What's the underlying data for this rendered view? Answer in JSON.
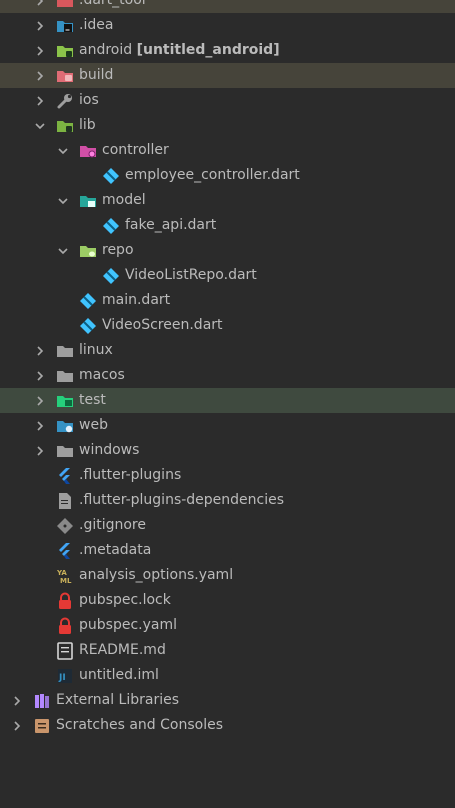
{
  "tree": [
    {
      "label": ".dart_tool",
      "depth": 1,
      "chev": "right",
      "icon": "folder-excluded-icon",
      "color": "#d9585d",
      "hl": "olive"
    },
    {
      "label": ".idea",
      "depth": 1,
      "chev": "right",
      "icon": "idea-folder-icon",
      "color": "#3592c4"
    },
    {
      "label": "android",
      "suffix": "[untitled_android]",
      "depth": 1,
      "chev": "right",
      "icon": "android-module-folder-icon",
      "color": "#8bc34a"
    },
    {
      "label": "build",
      "depth": 1,
      "chev": "right",
      "icon": "build-folder-icon",
      "color": "#e06c75",
      "hl": "olive"
    },
    {
      "label": "ios",
      "depth": 1,
      "chev": "right",
      "icon": "wrench-icon",
      "color": "#9e9e9e"
    },
    {
      "label": "lib",
      "depth": 1,
      "chev": "down",
      "icon": "source-folder-icon",
      "color": "#7cb342"
    },
    {
      "label": "controller",
      "depth": 2,
      "chev": "down",
      "icon": "controller-folder-icon",
      "color": "#e040fb"
    },
    {
      "label": "employee_controller.dart",
      "depth": 3,
      "icon": "dart-file-icon",
      "color": "#40c4ff"
    },
    {
      "label": "model",
      "depth": 2,
      "chev": "down",
      "icon": "model-folder-icon",
      "color": "#26a69a"
    },
    {
      "label": "fake_api.dart",
      "depth": 3,
      "icon": "dart-file-icon",
      "color": "#40c4ff"
    },
    {
      "label": "repo",
      "depth": 2,
      "chev": "down",
      "icon": "repo-folder-icon",
      "color": "#9ccc65"
    },
    {
      "label": "VideoListRepo.dart",
      "depth": 3,
      "icon": "dart-file-icon",
      "color": "#40c4ff"
    },
    {
      "label": "main.dart",
      "depth": 2,
      "icon": "dart-file-icon",
      "color": "#40c4ff"
    },
    {
      "label": "VideoScreen.dart",
      "depth": 2,
      "icon": "dart-file-icon",
      "color": "#40c4ff"
    },
    {
      "label": "linux",
      "depth": 1,
      "chev": "right",
      "icon": "folder-icon",
      "color": "#9e9e9e"
    },
    {
      "label": "macos",
      "depth": 1,
      "chev": "right",
      "icon": "folder-icon",
      "color": "#9e9e9e"
    },
    {
      "label": "test",
      "depth": 1,
      "chev": "right",
      "icon": "test-folder-icon",
      "color": "#26d07c",
      "hl": "green"
    },
    {
      "label": "web",
      "depth": 1,
      "chev": "right",
      "icon": "web-folder-icon",
      "color": "#3592c4"
    },
    {
      "label": "windows",
      "depth": 1,
      "chev": "right",
      "icon": "folder-icon",
      "color": "#9e9e9e"
    },
    {
      "label": ".flutter-plugins",
      "depth": 1,
      "icon": "flutter-icon",
      "color": "#42a5f5"
    },
    {
      "label": ".flutter-plugins-dependencies",
      "depth": 1,
      "icon": "text-file-icon",
      "color": "#9e9e9e"
    },
    {
      "label": ".gitignore",
      "depth": 1,
      "icon": "git-icon",
      "color": "#8a8a8a"
    },
    {
      "label": ".metadata",
      "depth": 1,
      "icon": "flutter-icon",
      "color": "#42a5f5"
    },
    {
      "label": "analysis_options.yaml",
      "depth": 1,
      "icon": "yaml-icon",
      "color": "#c8b05a"
    },
    {
      "label": "pubspec.lock",
      "depth": 1,
      "icon": "lock-icon",
      "color": "#e53935"
    },
    {
      "label": "pubspec.yaml",
      "depth": 1,
      "icon": "lock-icon",
      "color": "#e53935"
    },
    {
      "label": "README.md",
      "depth": 1,
      "icon": "markdown-icon",
      "color": "#d6d6d6"
    },
    {
      "label": "untitled.iml",
      "depth": 1,
      "icon": "iml-icon",
      "color": "#3592c4"
    },
    {
      "label": "External Libraries",
      "depth": 0,
      "chev": "right",
      "icon": "libraries-icon",
      "color": "#b388ff"
    },
    {
      "label": "Scratches and Consoles",
      "depth": 0,
      "chev": "right",
      "icon": "scratches-icon",
      "color": "#c9956b"
    }
  ]
}
